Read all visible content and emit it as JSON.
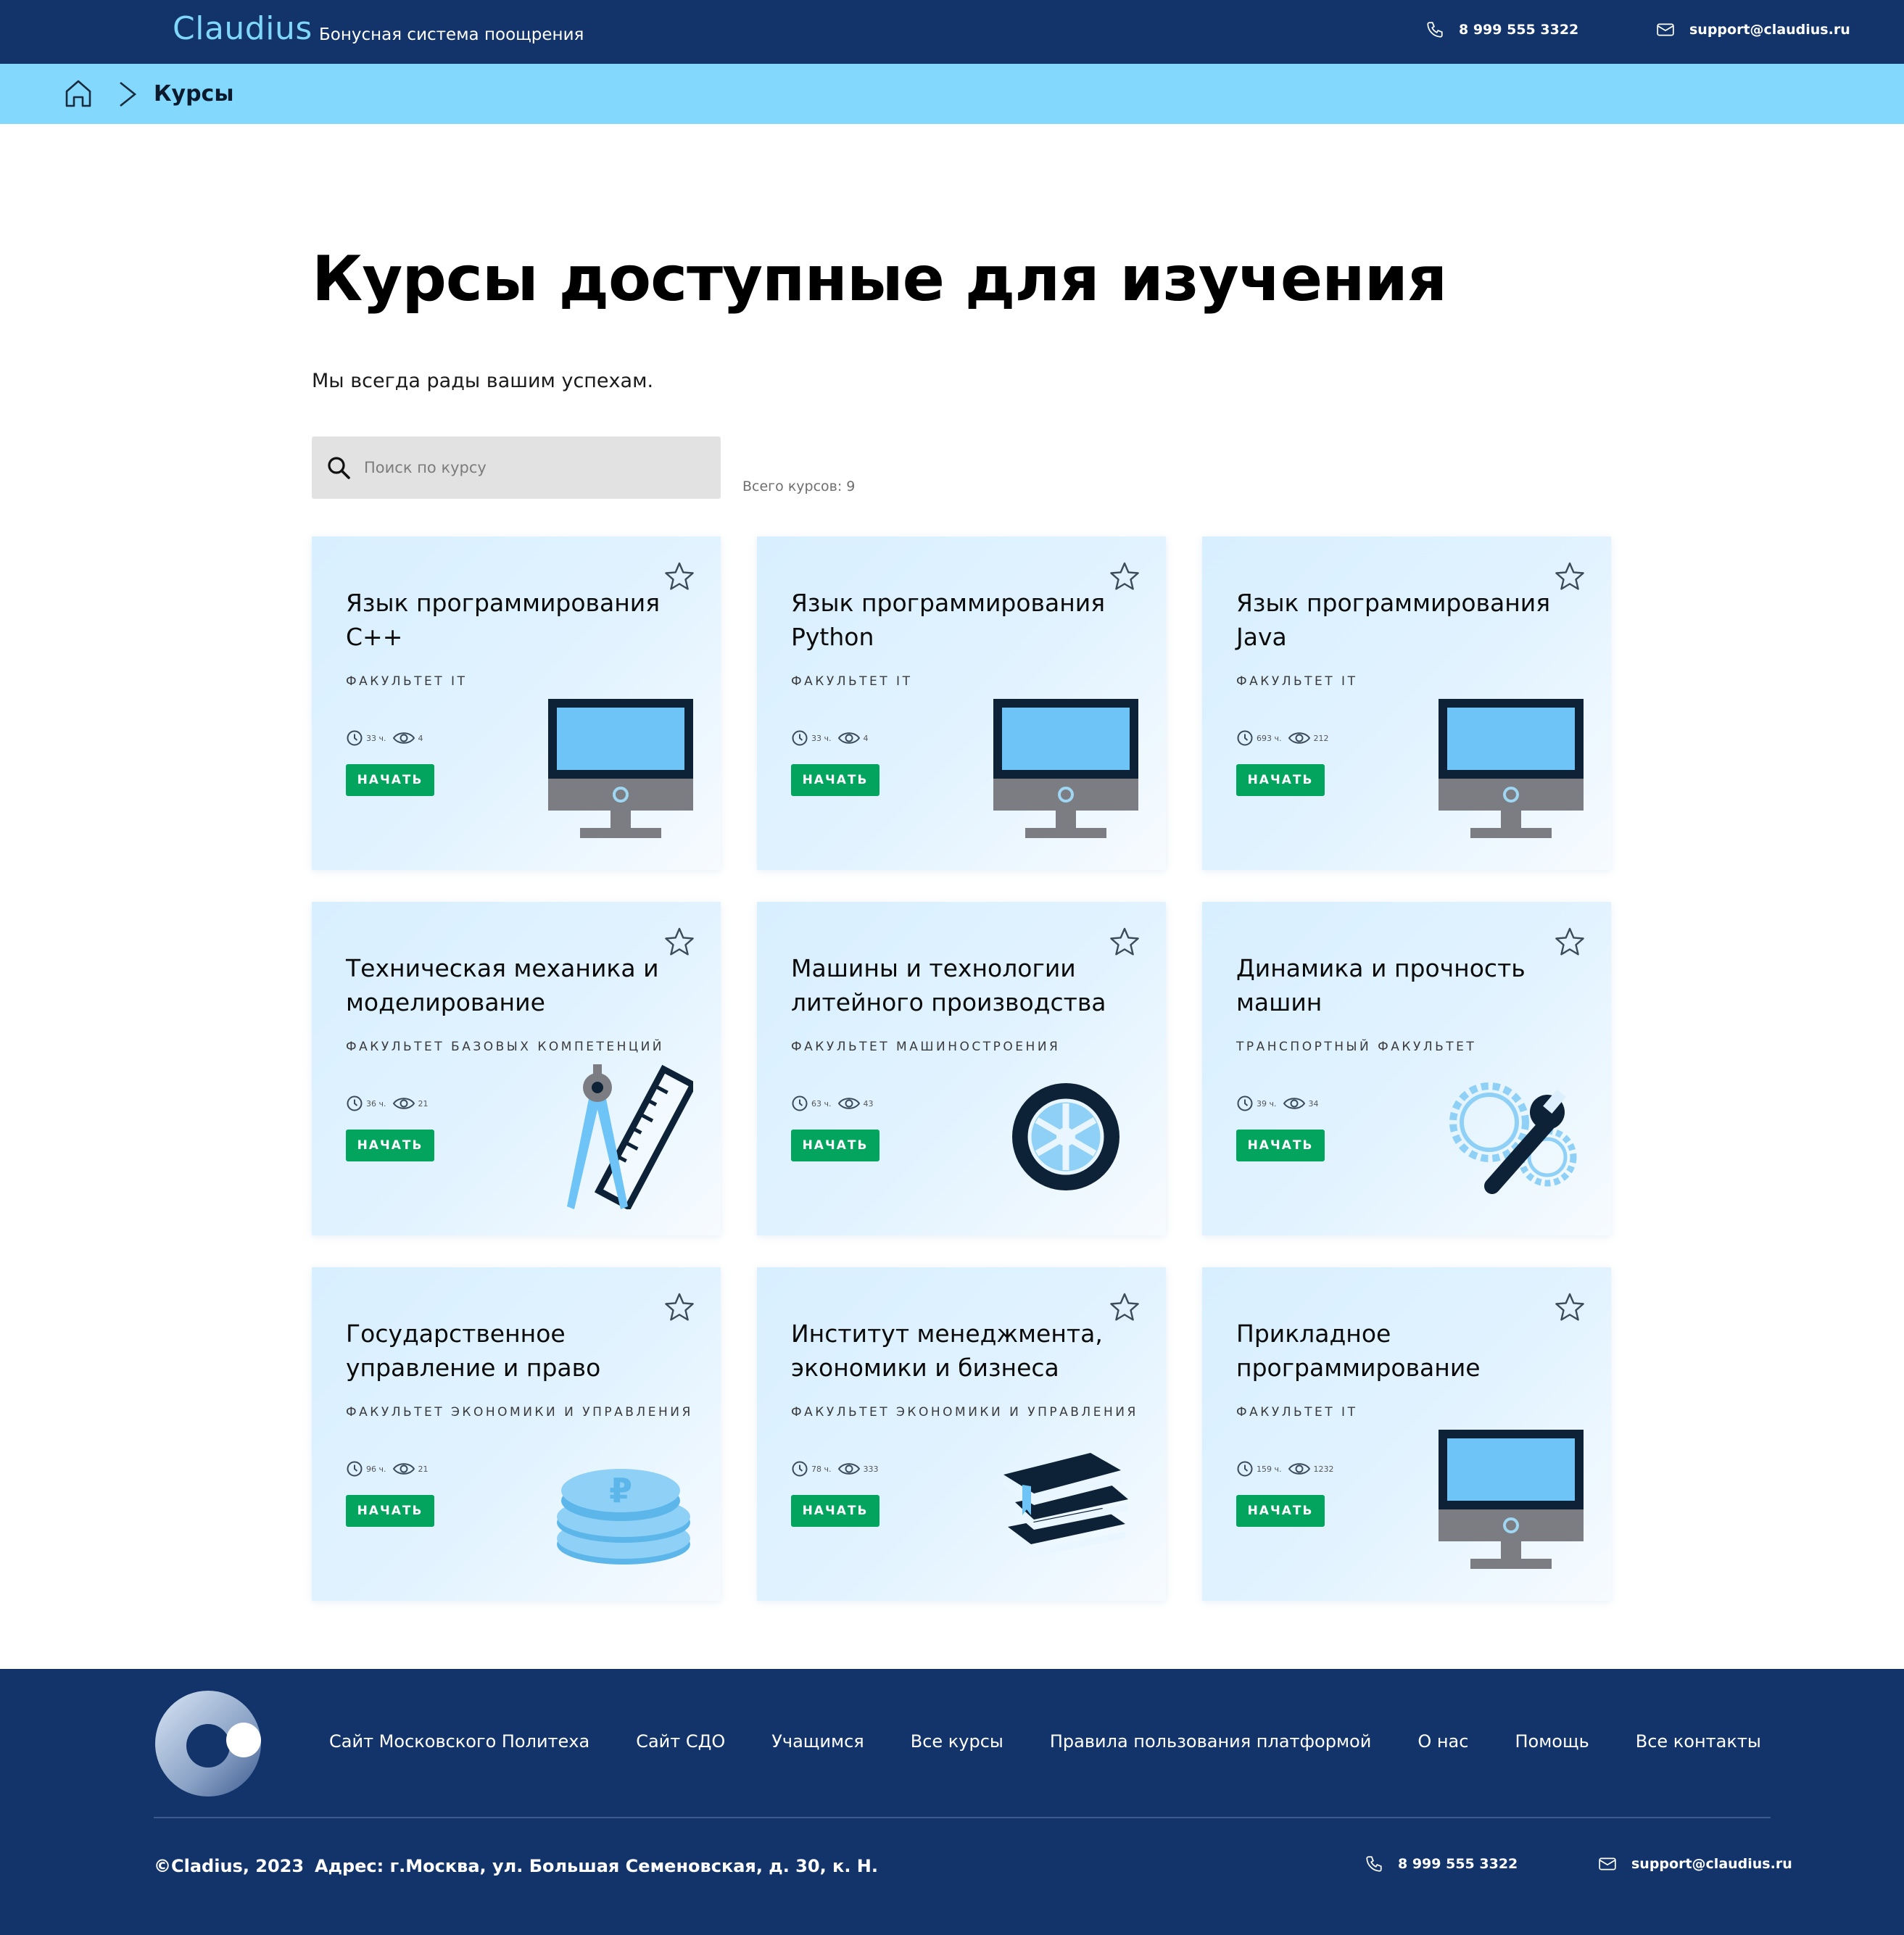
{
  "header": {
    "brand": "Claudius",
    "tagline": "Бонусная система поощрения",
    "phone": "8 999 555 3322",
    "email": "support@claudius.ru"
  },
  "breadcrumb": {
    "current": "Курсы"
  },
  "main": {
    "title": "Курсы доступные для изучения",
    "subtitle": "Мы всегда рады вашим успехам.",
    "search_placeholder": "Поиск по курсу",
    "total_courses": "Всего курсов: 9",
    "start_label": "НАЧАТЬ"
  },
  "courses": [
    {
      "title": "Язык программирования C++",
      "faculty": "Факультет IT",
      "hours": "33 ч.",
      "views": "4",
      "icon": "monitor-icon"
    },
    {
      "title": "Язык программирования Python",
      "faculty": "Факультет IT",
      "hours": "33 ч.",
      "views": "4",
      "icon": "monitor-icon"
    },
    {
      "title": "Язык программирования Java",
      "faculty": "Факультет IT",
      "hours": "693 ч.",
      "views": "212",
      "icon": "monitor-icon"
    },
    {
      "title": "Техническая механика и моделирование",
      "faculty": "Факультет базовых компетенций",
      "hours": "36 ч.",
      "views": "21",
      "icon": "compass-ruler-icon"
    },
    {
      "title": "Машины и технологии литейного производства",
      "faculty": "Факультет машиностроения",
      "hours": "63 ч.",
      "views": "43",
      "icon": "wheel-icon"
    },
    {
      "title": "Динамика и прочность машин",
      "faculty": "Транспортный факультет",
      "hours": "39 ч.",
      "views": "34",
      "icon": "gears-wrench-icon"
    },
    {
      "title": "Государственное управление и право",
      "faculty": "Факультет экономики и управления",
      "hours": "96 ч.",
      "views": "21",
      "icon": "ruble-coins-icon"
    },
    {
      "title": "Институт менеджмента, экономики и бизнеса",
      "faculty": "Факультет экономики и управления",
      "hours": "78 ч.",
      "views": "333",
      "icon": "books-icon"
    },
    {
      "title": "Прикладное программирование",
      "faculty": "Факультет IT",
      "hours": "159 ч.",
      "views": "1232",
      "icon": "monitor-icon"
    }
  ],
  "footer": {
    "nav": [
      "Сайт Московского Политеха",
      "Сайт СДО",
      "Учащимся",
      "Все курсы",
      "Правила пользования платформой",
      "О нас",
      "Помощь",
      "Все контакты"
    ],
    "copyright": "©Cladius, 2023",
    "address": "Адрес: г.Москва, ул. Большая Семеновская, д. 30, к. Н.",
    "phone": "8 999 555 3322",
    "email": "support@claudius.ru"
  },
  "colors": {
    "header_bg": "#12346a",
    "breadcrumb_bg": "#82d8fd",
    "brand": "#7fd7fb",
    "button": "#03a45e"
  }
}
